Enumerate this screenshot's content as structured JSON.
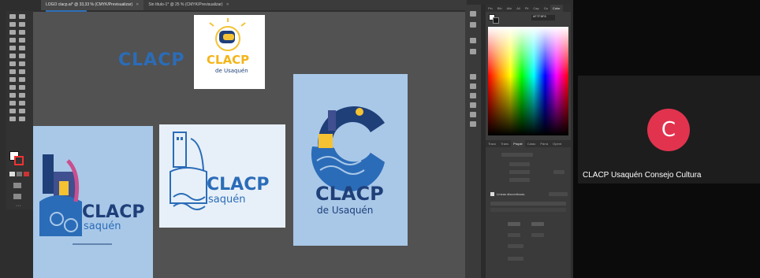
{
  "document_tabs": [
    {
      "label": "LOGO clacp.ai* @ 33,33 % (CMYK/Previsualizar)",
      "active": true
    },
    {
      "label": "Sin título-1* @ 25 % (CMYK/Previsualizar)",
      "active": false
    }
  ],
  "color_panel": {
    "tabs": [
      "Pin",
      "Bib",
      "Alin",
      "Ali",
      "Pti",
      "Cap",
      "Gu",
      "Color"
    ],
    "active_tab": "Color",
    "hex_value": "#F7F8F8"
  },
  "transform_panel": {
    "tabs": [
      "Trazo",
      "Trans",
      "Propie",
      "Carac",
      "Párra",
      "Opent"
    ],
    "active_tab": "Propie",
    "section_title": "Líneas discontinuas"
  },
  "artwork": {
    "wordmark": "CLACP",
    "card_logo": {
      "title": "CLACP",
      "subtitle": "de Usaquén"
    },
    "left_logo": {
      "title": "CLACP",
      "subtitle": "saquén"
    },
    "middle_logo": {
      "title": "CLACP",
      "subtitle": "saquén"
    },
    "right_logo": {
      "title": "CLACP",
      "subtitle": "de Usaquén"
    }
  },
  "colors": {
    "brand_blue": "#2b6cb8",
    "navy": "#1f3f79",
    "light_blue_sheet": "#a9c8e8",
    "accent_yellow": "#f4c233",
    "avatar_red": "#e1334e"
  },
  "participant": {
    "initial": "C",
    "name": "CLACP Usaquén Consejo Cultura"
  }
}
